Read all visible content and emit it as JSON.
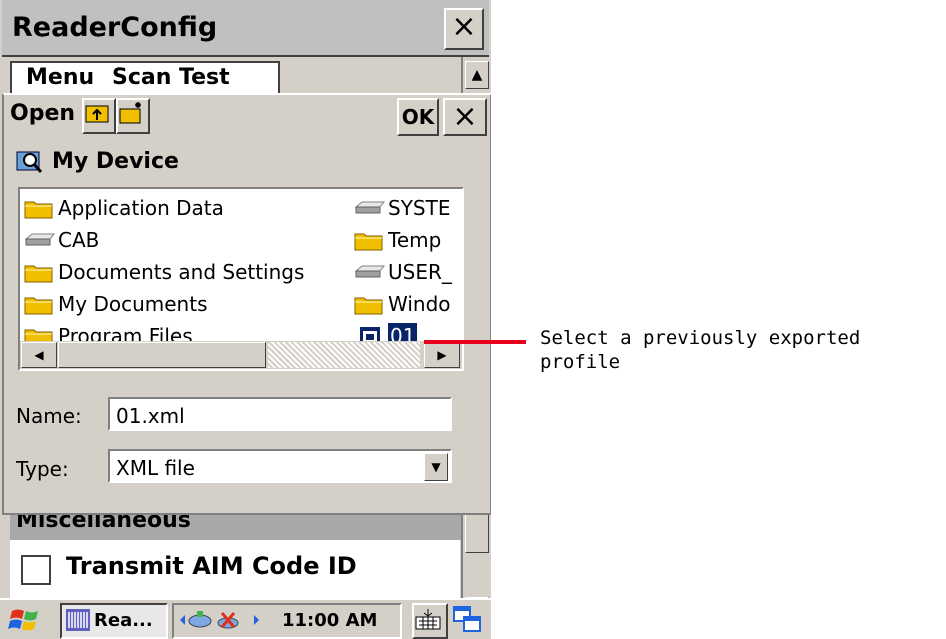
{
  "window": {
    "title": "ReaderConfig",
    "close_label": "×"
  },
  "menubar": {
    "items": [
      "Menu",
      "Scan Test"
    ]
  },
  "dialog": {
    "title": "Open",
    "ok_label": "OK",
    "close_label": "×",
    "location": "My Device",
    "files_col1": [
      {
        "name": "Application Data",
        "icon": "folder-icon"
      },
      {
        "name": "CAB",
        "icon": "drive-icon"
      },
      {
        "name": "Documents and Settings",
        "icon": "folder-icon"
      },
      {
        "name": "My Documents",
        "icon": "folder-icon"
      },
      {
        "name": "Program Files",
        "icon": "folder-icon"
      }
    ],
    "files_col2": [
      {
        "name": "SYSTE",
        "icon": "drive-icon"
      },
      {
        "name": "Temp",
        "icon": "folder-icon"
      },
      {
        "name": "USER_",
        "icon": "drive-icon"
      },
      {
        "name": "Windo",
        "icon": "folder-icon"
      },
      {
        "name": "01",
        "icon": "xml-file-icon",
        "selected": true
      }
    ],
    "name_label": "Name:",
    "name_value": "01.xml",
    "type_label": "Type:",
    "type_value": "XML file"
  },
  "background": {
    "section_header": "Miscellaneous",
    "checkbox_label": "Transmit AIM Code ID",
    "checkbox_checked": false
  },
  "taskbar": {
    "app_label": "Rea...",
    "clock": "11:00 AM"
  },
  "annotation": {
    "text": "Select a previously exported profile"
  },
  "colors": {
    "selection": "#0a246a",
    "callout": "#e8001c",
    "folder": "#f0c000"
  }
}
